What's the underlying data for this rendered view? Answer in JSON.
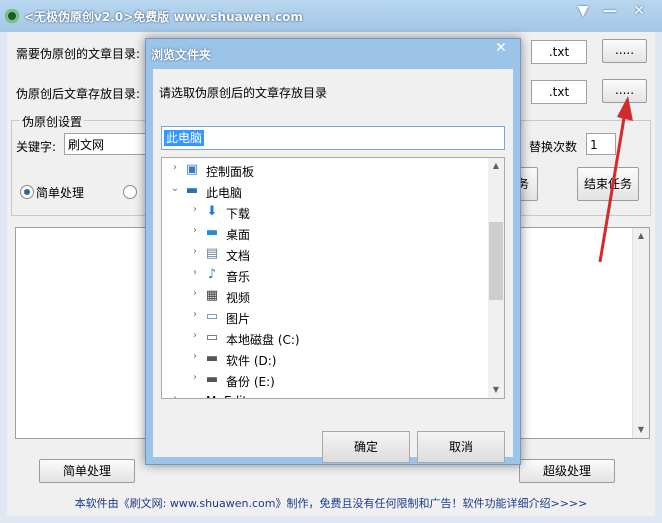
{
  "window": {
    "title": "<无极伪原创v2.0>免费版 www.shuawen.com",
    "buttons": {
      "menu": "▼",
      "minimize": "—",
      "close": "✕"
    }
  },
  "form": {
    "source_dir_label": "需要伪原创的文章目录:",
    "output_dir_label": "伪原创后文章存放目录:",
    "ext1": ".txt",
    "ext2": ".txt",
    "browse1": ".....",
    "browse2": ".....",
    "settings_group": "伪原创设置",
    "keyword_label": "关键字:",
    "keyword_value": "刷文网",
    "replace_count_label": "替换次数",
    "replace_count_value": "1",
    "radio_simple": "简单处理",
    "start_task_partial": "务",
    "end_task": "结束任务",
    "simple_btn": "简单处理",
    "super_btn": "超级处理",
    "footer": "本软件由《刷文网: www.shuawen.com》制作，免费且没有任何限制和广告！软件功能详细介绍>>>>"
  },
  "dialog": {
    "title": "浏览文件夹",
    "close": "✕",
    "hint": "请选取伪原创后的文章存放目录",
    "path": "此电脑",
    "tree": [
      {
        "label": "控制面板",
        "icon": "control-panel-icon",
        "glyph": "▣",
        "color": "#3a7bbf",
        "expanded": false,
        "level": 0
      },
      {
        "label": "此电脑",
        "icon": "computer-icon",
        "glyph": "▬",
        "color": "#2b6fb5",
        "expanded": true,
        "level": 0
      },
      {
        "label": "下载",
        "icon": "download-icon",
        "glyph": "⬇",
        "color": "#1f7ad6",
        "expanded": false,
        "level": 1
      },
      {
        "label": "桌面",
        "icon": "desktop-icon",
        "glyph": "▬",
        "color": "#2a8ad8",
        "expanded": false,
        "level": 1
      },
      {
        "label": "文档",
        "icon": "document-icon",
        "glyph": "▤",
        "color": "#6b7c8f",
        "expanded": false,
        "level": 1
      },
      {
        "label": "音乐",
        "icon": "music-icon",
        "glyph": "♪",
        "color": "#1f7ad6",
        "expanded": false,
        "level": 1
      },
      {
        "label": "视频",
        "icon": "video-icon",
        "glyph": "▦",
        "color": "#3b3b3b",
        "expanded": false,
        "level": 1
      },
      {
        "label": "图片",
        "icon": "picture-icon",
        "glyph": "▭",
        "color": "#4a7fb0",
        "expanded": false,
        "level": 1
      },
      {
        "label": "本地磁盘 (C:)",
        "icon": "system-drive-icon",
        "glyph": "▭",
        "color": "#555555",
        "expanded": false,
        "level": 1
      },
      {
        "label": "软件 (D:)",
        "icon": "drive-icon",
        "glyph": "▬",
        "color": "#555555",
        "expanded": false,
        "level": 1
      },
      {
        "label": "备份 (E:)",
        "icon": "drive-icon",
        "glyph": "▬",
        "color": "#555555",
        "expanded": false,
        "level": 1
      },
      {
        "label": "M. Edit",
        "icon": "folder-icon",
        "glyph": "▬",
        "color": "#e8c15a",
        "expanded": false,
        "level": 0
      }
    ],
    "ok": "确定",
    "cancel": "取消"
  },
  "colors": {
    "accent": "#3399ff",
    "arrow": "#d42a2a"
  }
}
